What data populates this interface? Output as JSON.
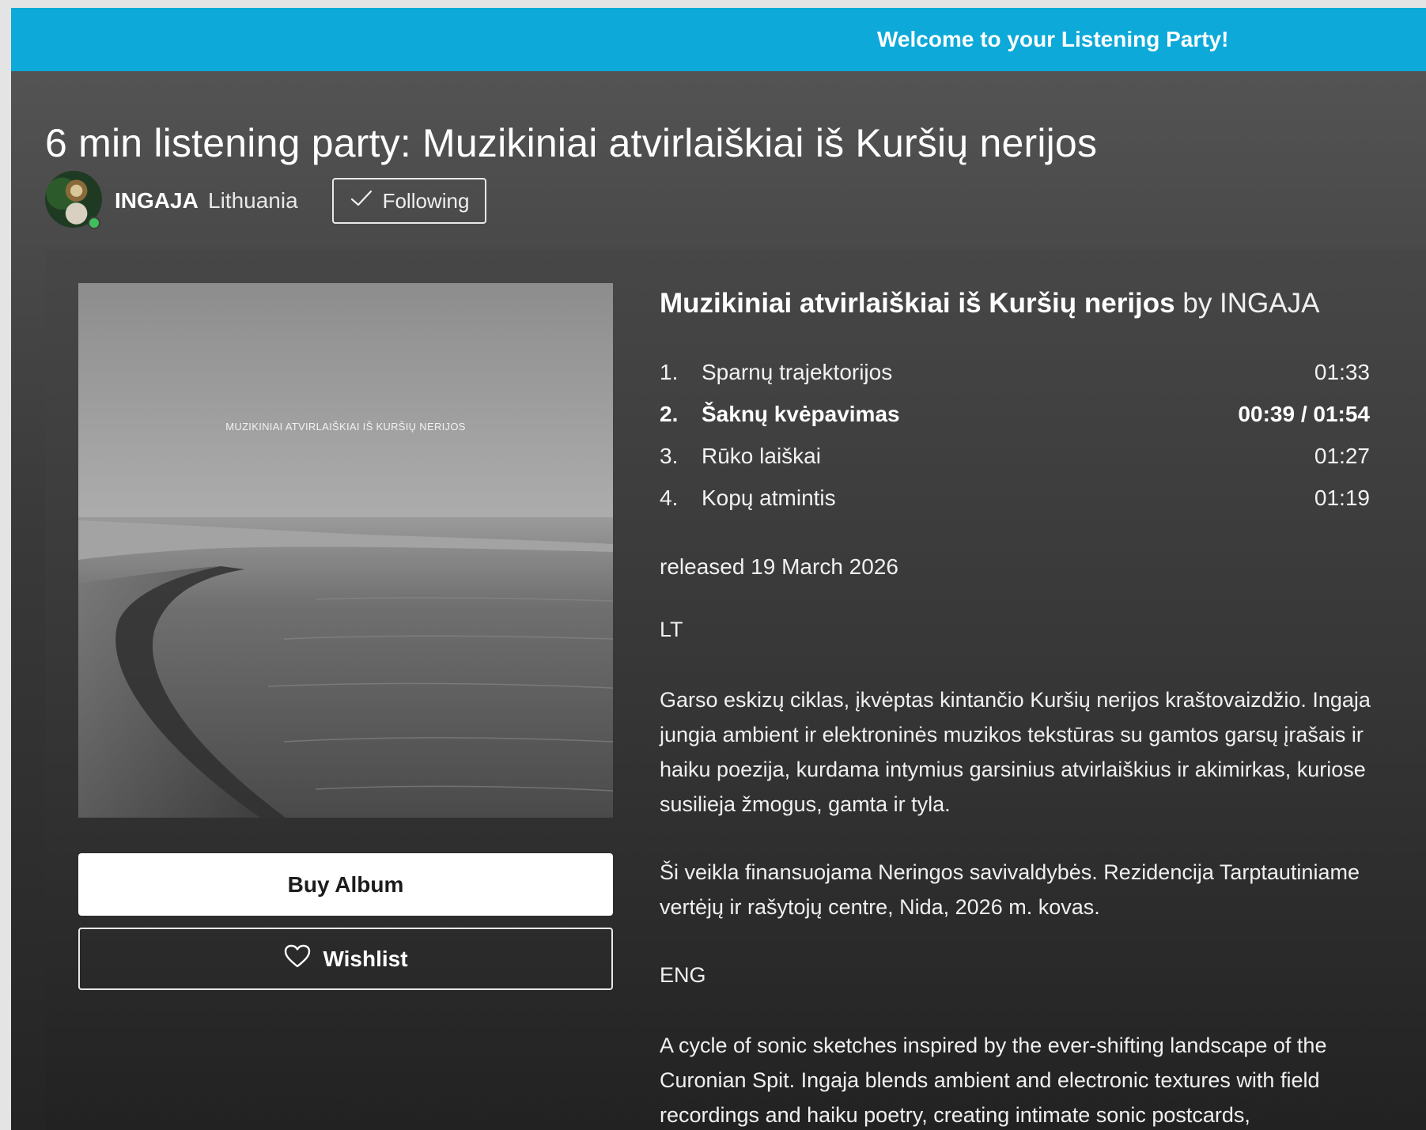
{
  "banner": {
    "text": "Welcome to your Listening Party!"
  },
  "page": {
    "title": "6 min listening party: Muzikiniai atvirlaiškiai iš Kuršių nerijos"
  },
  "artist": {
    "name": "INGAJA",
    "location": "Lithuania",
    "follow_label": "Following"
  },
  "album": {
    "name": "Muzikiniai atvirlaiškiai iš Kuršių nerijos",
    "by": "by INGAJA",
    "cover_caption": "MUZIKINIAI ATVIRLAIŠKIAI IŠ KURŠIŲ NERIJOS",
    "released": "released 19 March 2026",
    "tracks": [
      {
        "number": "1.",
        "title": "Sparnų trajektorijos",
        "time": "01:33"
      },
      {
        "number": "2.",
        "title": "Šaknų kvėpavimas",
        "time": "00:39 / 01:54",
        "playing": true
      },
      {
        "number": "3.",
        "title": "Rūko laiškai",
        "time": "01:27"
      },
      {
        "number": "4.",
        "title": "Kopų atmintis",
        "time": "01:19"
      }
    ]
  },
  "actions": {
    "buy_label": "Buy Album",
    "wishlist_label": "Wishlist"
  },
  "description": {
    "lt_label": "LT",
    "lt_paragraph_1": "Garso eskizų ciklas, įkvėptas kintančio Kuršių nerijos kraštovaizdžio. Ingaja jungia ambient ir elektroninės muzikos tekstūras su gamtos garsų įrašais ir haiku poezija, kurdama intymius garsinius atvirlaiškius ir akimirkas, kuriose susilieja žmogus, gamta ir tyla.",
    "lt_paragraph_2": "Ši veikla finansuojama Neringos savivaldybės. Rezidencija Tarptautiniame vertėjų ir rašytojų centre, Nida, 2026 m. kovas.",
    "en_label": "ENG",
    "en_paragraph_1": "A cycle of sonic sketches inspired by the ever-shifting landscape of the Curonian Spit. Ingaja blends ambient and electronic textures with field recordings and haiku poetry, creating intimate sonic postcards,"
  },
  "colors": {
    "banner": "#0ca9d9",
    "online": "#3fbe5a"
  },
  "icons": {
    "follow": "checkmark-icon",
    "wishlist": "heart-icon"
  }
}
